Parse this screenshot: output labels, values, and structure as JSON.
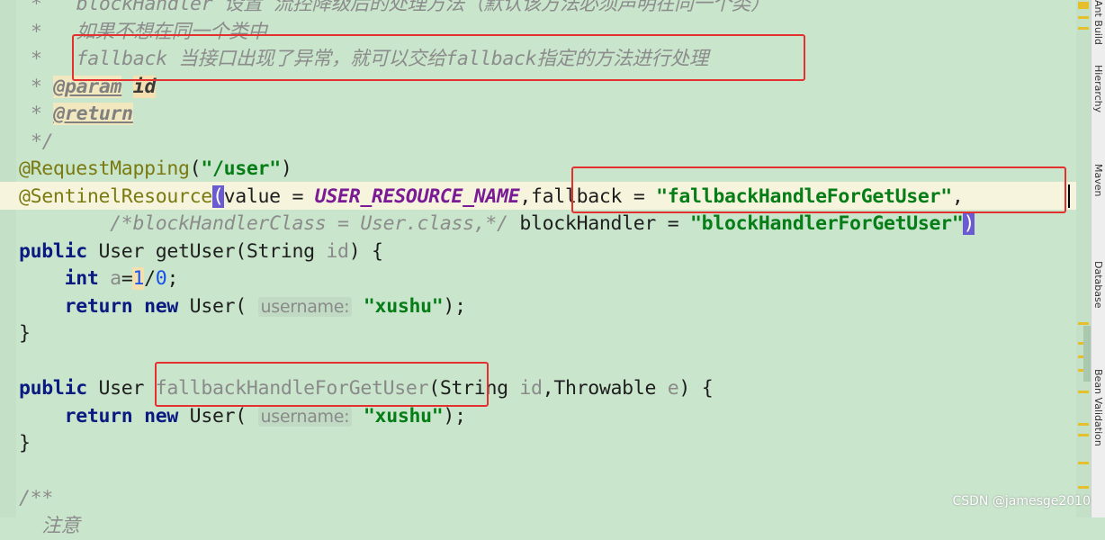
{
  "code_lines": [
    [
      [
        "*   blockHandler 设置 流控降级后的处理方法（默认该方法必须声明在同一个类）",
        "cm"
      ]
    ],
    [
      [
        "*   如果不想在同一个类中",
        "cm"
      ]
    ],
    [
      [
        "*   fallback 当接口出现了异常，就可以交给fallback指定的方法进行处理",
        "cm"
      ]
    ],
    [
      [
        "* ",
        "cm"
      ],
      [
        "@param",
        "tag"
      ],
      [
        " ",
        "cm"
      ],
      [
        "id",
        "tagv"
      ]
    ],
    [
      [
        "* ",
        "cm"
      ],
      [
        "@return",
        "tag"
      ]
    ],
    [
      [
        "*/",
        "cm"
      ]
    ],
    [
      [
        "@RequestMapping",
        "ann"
      ],
      [
        "(",
        ""
      ],
      [
        "\"/user\"",
        "str"
      ],
      [
        ")",
        ""
      ]
    ],
    [
      [
        "@SentinelResource",
        "ann"
      ],
      [
        "(",
        "brace"
      ],
      [
        "value = ",
        ""
      ],
      [
        "USER_RESOURCE_NAME",
        "const"
      ],
      [
        ",fallback = ",
        ""
      ],
      [
        "\"fallbackHandleForGetUser\"",
        "str"
      ],
      [
        ",",
        ""
      ]
    ],
    [
      [
        "        ",
        ""
      ],
      [
        "/*blockHandlerClass = User.class,*/",
        "cm"
      ],
      [
        " blockHandler = ",
        ""
      ],
      [
        "\"blockHandlerForGetUser\"",
        "str"
      ],
      [
        ")",
        "brace"
      ]
    ],
    [
      [
        "public",
        "kw"
      ],
      [
        " User getUser(String ",
        ""
      ],
      [
        "id",
        "param"
      ],
      [
        ") {",
        ""
      ]
    ],
    [
      [
        "    ",
        ""
      ],
      [
        "int",
        "kw"
      ],
      [
        " ",
        ""
      ],
      [
        "a",
        "param"
      ],
      [
        "=",
        ""
      ],
      [
        "1",
        "numh"
      ],
      [
        "/",
        ""
      ],
      [
        "0",
        "num"
      ],
      [
        ";",
        ""
      ]
    ],
    [
      [
        "    ",
        ""
      ],
      [
        "return new",
        "kw"
      ],
      [
        " User( ",
        ""
      ],
      [
        "username:",
        "hint"
      ],
      [
        " ",
        ""
      ],
      [
        "\"xushu\"",
        "str"
      ],
      [
        ");",
        ""
      ]
    ],
    [
      [
        "}",
        ""
      ]
    ],
    [
      [
        "",
        ""
      ]
    ],
    [
      [
        "public",
        "kw"
      ],
      [
        " User ",
        ""
      ],
      [
        "fallbackHandleForGetUser",
        "unused"
      ],
      [
        "(String ",
        ""
      ],
      [
        "id",
        "param"
      ],
      [
        ",Throwable ",
        ""
      ],
      [
        "e",
        "param"
      ],
      [
        ") {",
        ""
      ]
    ],
    [
      [
        "    ",
        ""
      ],
      [
        "return new",
        "kw"
      ],
      [
        " User( ",
        ""
      ],
      [
        "username:",
        "hint"
      ],
      [
        " ",
        ""
      ],
      [
        "\"xushu\"",
        "str"
      ],
      [
        ");",
        ""
      ]
    ],
    [
      [
        "}",
        ""
      ]
    ],
    [
      [
        "",
        ""
      ]
    ],
    [
      [
        "/**",
        "cm"
      ]
    ],
    [
      [
        "  注意",
        "cm"
      ]
    ]
  ],
  "tool_windows": [
    "Ant Build",
    "Hierarchy",
    "Maven",
    "Database",
    "Bean Validation"
  ],
  "watermark": "CSDN @jamesge2010",
  "colors": {
    "editor_bg": "#c9e5cc",
    "highlight_box": "#e53030",
    "string": "#067d17",
    "keyword": "#0a1a80"
  }
}
